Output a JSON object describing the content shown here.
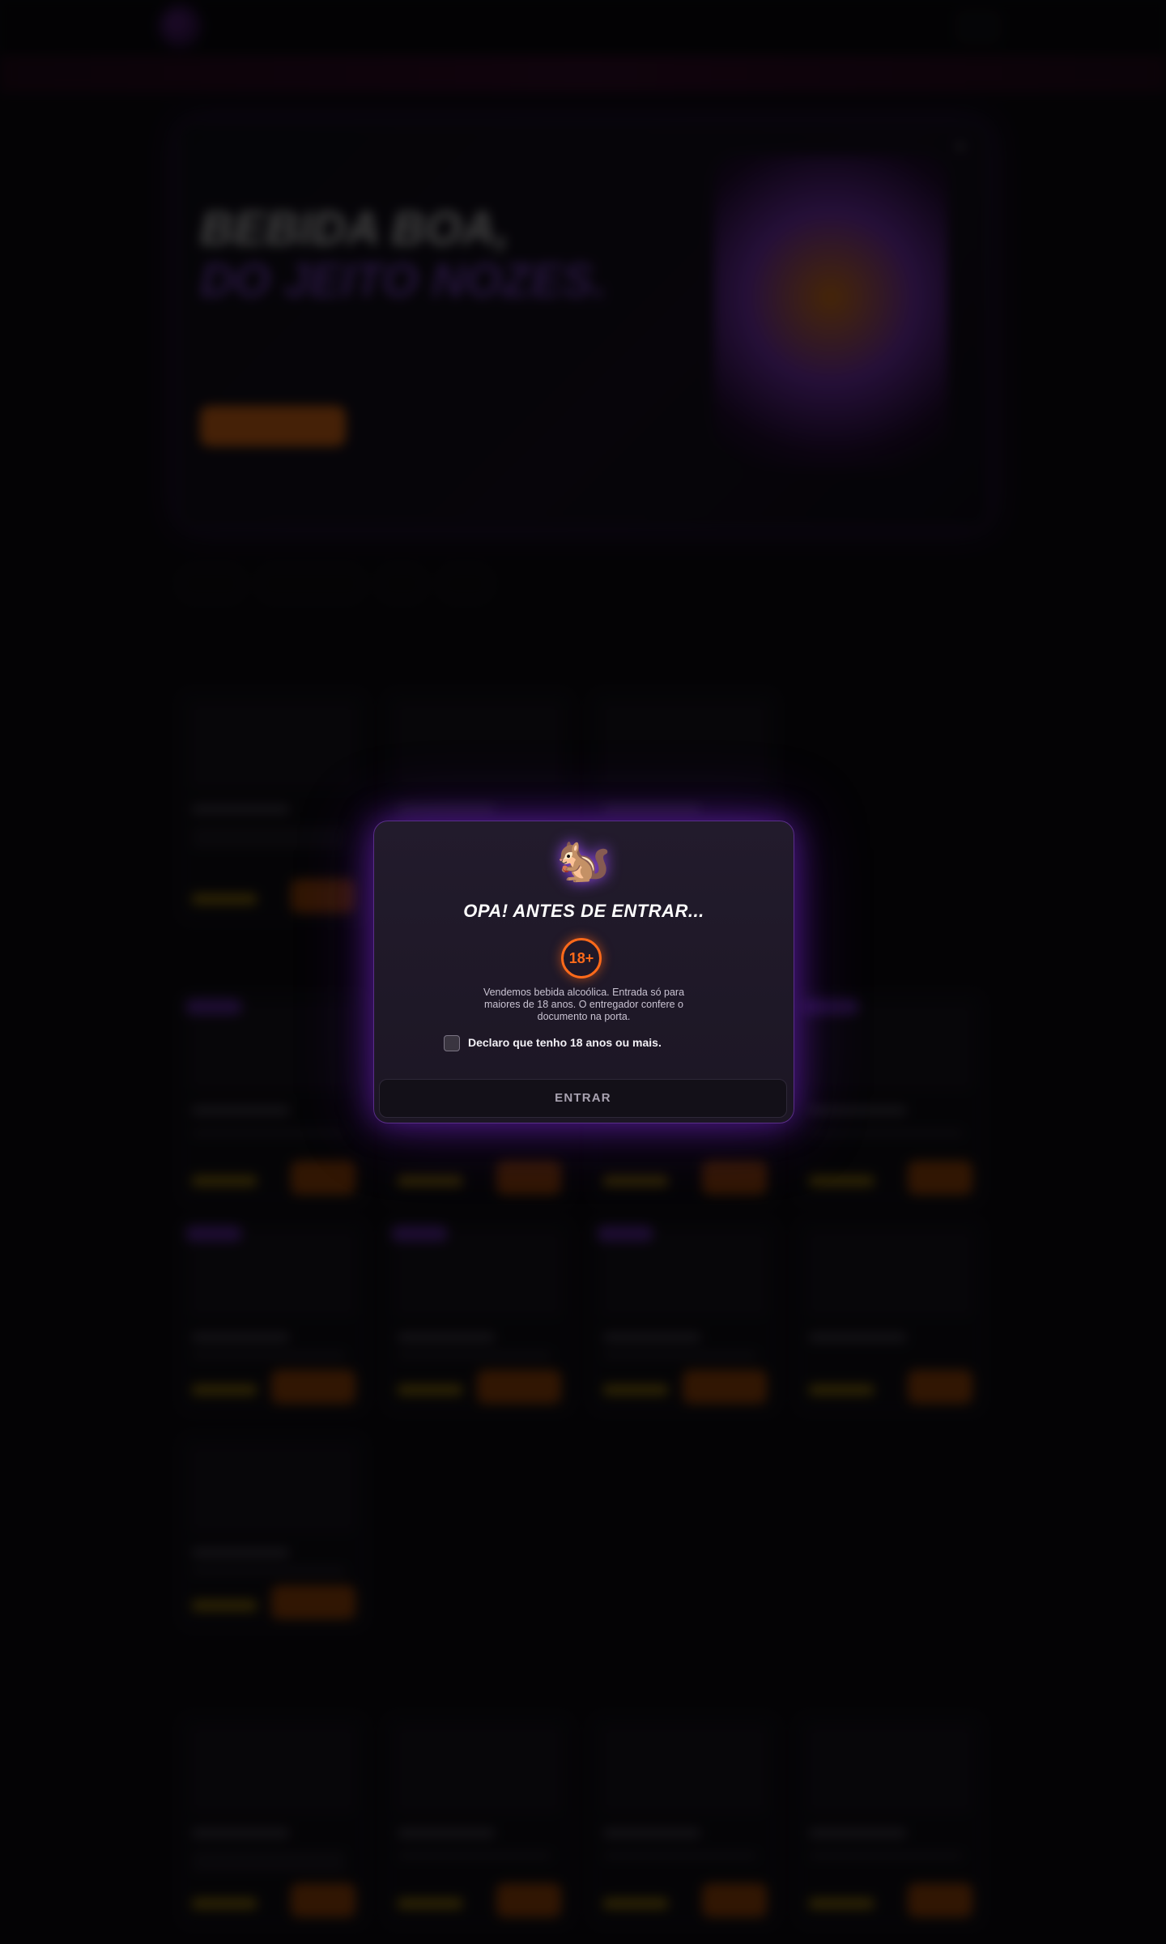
{
  "background": {
    "brand": "",
    "brand_sub": "",
    "ticker_text": "",
    "hero": {
      "headline_line1": "BEBIDA BOA,",
      "headline_line2": "DO JEITO NOZES.",
      "subhead": "",
      "cta": ""
    }
  },
  "modal": {
    "icon": "squirrel-icon",
    "icon_glyph": "🐿️",
    "title": "OPA! ANTES DE ENTRAR...",
    "age_badge": "18+",
    "description": "Vendemos bebida alcoólica. Entrada só para maiores de 18 anos. O entregador confere o documento na porta.",
    "checkbox_label": "Declaro que tenho 18 anos ou mais.",
    "checkbox_checked": false,
    "submit_label": "ENTRAR"
  },
  "colors": {
    "accent_orange": "#ff6a1a",
    "accent_purple": "#7b2fbf",
    "background": "#070609"
  }
}
